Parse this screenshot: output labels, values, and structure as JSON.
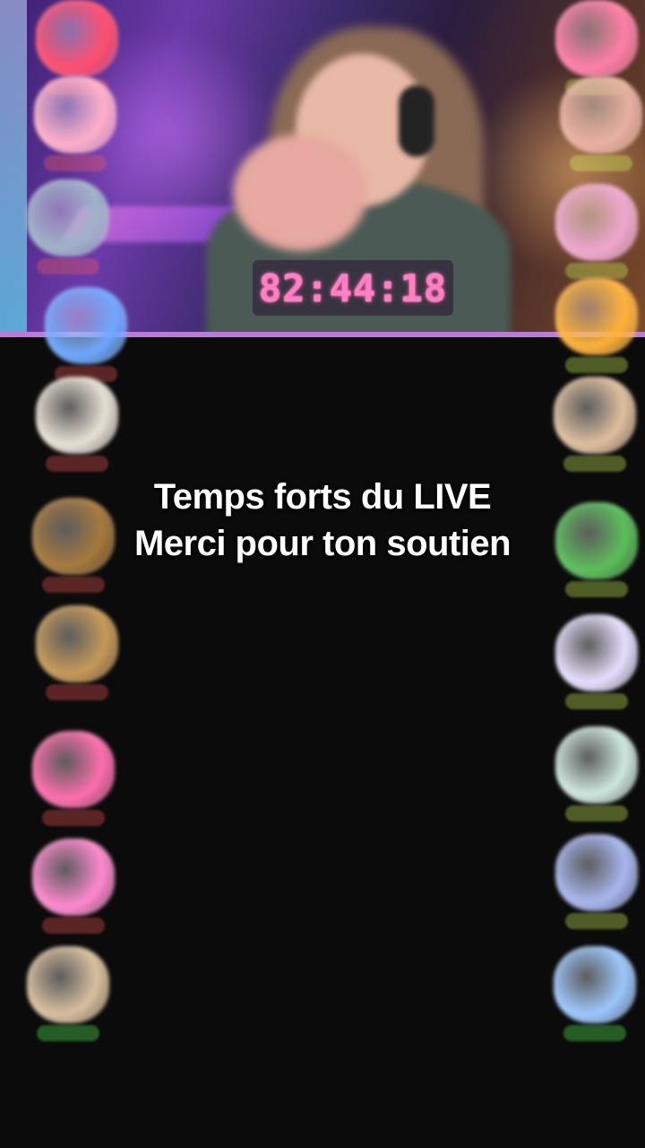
{
  "stream": {
    "timer": "82:44:18"
  },
  "caption": {
    "line1": "Temps forts du LIVE",
    "line2": "Merci pour ton soutien"
  },
  "colors": {
    "background": "#0b0b0b",
    "timer": "#ff7fc4",
    "video_border": "#b97bd6"
  },
  "left_gifts": [
    {
      "icon": "rose-gift-icon",
      "label": "",
      "color": "#ff5a5a",
      "art": "#ff4f6e"
    },
    {
      "icon": "donut-gift-icon",
      "label": "",
      "color": "#ff5a5a",
      "art": "#ffb0c8"
    },
    {
      "icon": "astronaut-gift-icon",
      "label": "",
      "color": "#ff5a5a",
      "art": "#9fb3c8"
    },
    {
      "icon": "sparkle-gift-icon",
      "label": "",
      "color": "#ff5a5a",
      "art": "#6fa8ff"
    },
    {
      "icon": "giraffe-gift-icon",
      "label": "",
      "color": "#ff5a5a",
      "art": "#e8e2d6"
    },
    {
      "icon": "bear-gift-icon",
      "label": "",
      "color": "#ff5a5a",
      "art": "#a87a3e"
    },
    {
      "icon": "lion-gift-icon",
      "label": "",
      "color": "#ff5a5a",
      "art": "#c79a5a"
    },
    {
      "icon": "pink-car-gift-icon",
      "label": "",
      "color": "#ff5a5a",
      "art": "#ff6fae"
    },
    {
      "icon": "convertible-gift-icon",
      "label": "",
      "color": "#ff5a5a",
      "art": "#ff8ad0"
    },
    {
      "icon": "llama-gift-icon",
      "label": "",
      "color": "#5cff5c",
      "art": "#d9c0a0"
    }
  ],
  "right_gifts": [
    {
      "icon": "heart-box-gift-icon",
      "label": "",
      "color": "#d7ff5a",
      "art": "#ff7fa8"
    },
    {
      "icon": "fox-gift-icon",
      "label": "",
      "color": "#d7ff5a",
      "art": "#e8b0a0"
    },
    {
      "icon": "pink-gift-gift-icon",
      "label": "",
      "color": "#d7ff5a",
      "art": "#f0a8d0"
    },
    {
      "icon": "dino-gift-icon",
      "label": "",
      "color": "#d7ff5a",
      "art": "#ffb23a"
    },
    {
      "icon": "bunny-gift-icon",
      "label": "",
      "color": "#d7ff5a",
      "art": "#e0c0a0"
    },
    {
      "icon": "flower-frog-gift-icon",
      "label": "",
      "color": "#d7ff5a",
      "art": "#5cc05c"
    },
    {
      "icon": "pegasus-gift-icon",
      "label": "",
      "color": "#d7ff5a",
      "art": "#e8e0ff"
    },
    {
      "icon": "eagle-gift-icon",
      "label": "",
      "color": "#d7ff5a",
      "art": "#cfe8e0"
    },
    {
      "icon": "elephant-gift-icon",
      "label": "",
      "color": "#d7ff5a",
      "art": "#a9b8f0"
    },
    {
      "icon": "castle-gift-icon",
      "label": "",
      "color": "#5cff5c",
      "art": "#9ec8ff"
    }
  ]
}
